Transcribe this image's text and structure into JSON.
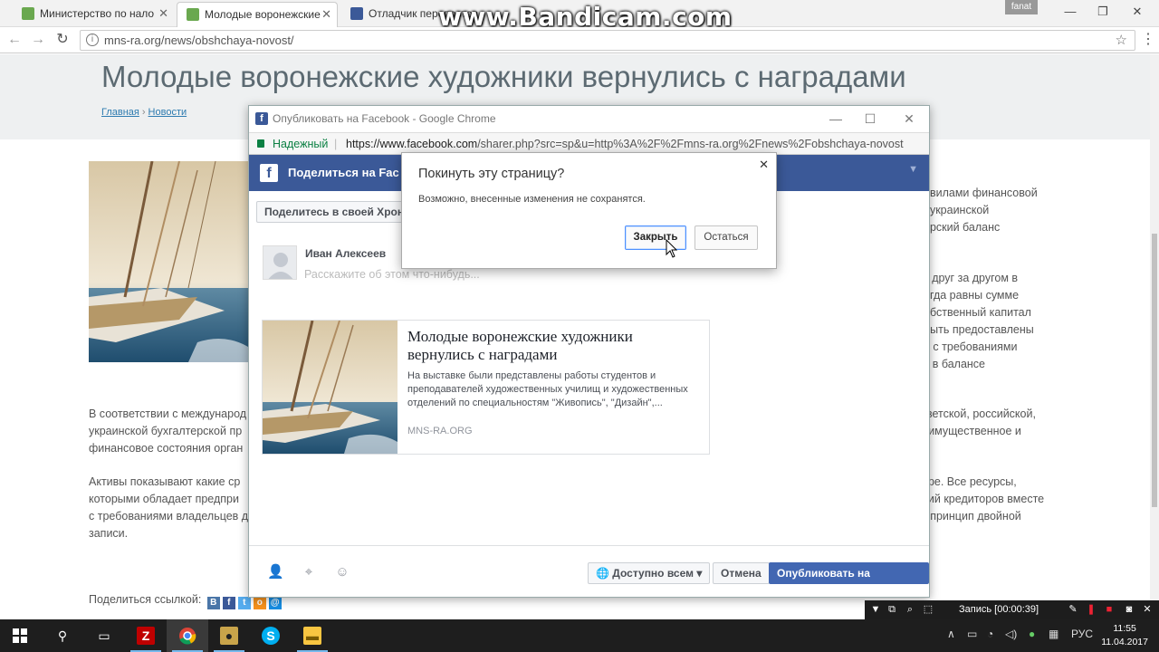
{
  "watermark": "www.Bandicam.com",
  "browser": {
    "tabs": [
      {
        "title": "Министерство по нало",
        "favicon_color": "#6aa84f"
      },
      {
        "title": "Молодые воронежские",
        "favicon_color": "#6aa84f"
      },
      {
        "title": "Отладчик перепостов",
        "favicon_color": "#3b5998"
      }
    ],
    "user_badge": "fanat",
    "url": "mns-ra.org/news/obshchaya-novost/",
    "window_controls": {
      "minimize": "—",
      "maximize": "❐",
      "close": "✕"
    }
  },
  "page": {
    "title": "Молодые воронежские художники вернулись с наградами",
    "breadcrumb": {
      "home": "Главная",
      "news": "Новости"
    },
    "right_col_1": [
      "авилами финансовой",
      ", украинской",
      "ерский баланс"
    ],
    "right_col_2": [
      "т друг за другом в",
      "егда равны сумме",
      "обственный капитал",
      "быть предоставлены",
      "е с требованиями",
      "х в балансе"
    ],
    "para1_left": [
      "В соответствии с международ",
      "украинской бухгалтерской пр",
      "финансовое состояния орган"
    ],
    "para1_right": [
      "оветской, российской,",
      "т имущественное и"
    ],
    "para2_left": [
      "Активы показывают какие ср",
      "которыми обладает предпри",
      "с требованиями владельцев д",
      "записи."
    ],
    "para2_right": [
      "ере. Все ресурсы,",
      "ний кредиторов вместе",
      "т принцип двойной"
    ],
    "share_label": "Поделиться ссылкой:"
  },
  "popup": {
    "window_title": "Опубликовать на Facebook - Google Chrome",
    "secure_label": "Надежный",
    "url_host": "https://www.facebook.com",
    "url_rest": "/sharer.php?src=sp&u=http%3A%2F%2Fmns-ra.org%2Fnews%2Fobshchaya-novost",
    "fb_header": "Поделиться на Fac",
    "share_where": "Поделитесь в своей Хрони",
    "user_name": "Иван Алексеев",
    "composer_placeholder": "Расскажите об этом что-нибудь...",
    "link": {
      "title": "Молодые воронежские художники вернулись с наградами",
      "description": "На выставке были представлены работы студентов и преподавателей художественных училищ и художественных отделений по специальностям \"Живопись\", \"Дизайн\",...",
      "domain": "MNS-RA.ORG"
    },
    "audience_label": "Доступно всем",
    "cancel_label": "Отмена",
    "publish_label": "Опубликовать на Facebook"
  },
  "dialog": {
    "title": "Покинуть эту страницу?",
    "message": "Возможно, внесенные изменения не сохранятся.",
    "close_label": "Закрыть",
    "stay_label": "Остаться"
  },
  "recorder": {
    "status": "Запись [00:00:39]"
  },
  "taskbar": {
    "lang": "РУС",
    "time": "11:55",
    "date": "11.04.2017"
  },
  "colors": {
    "facebook_blue": "#3b5998",
    "publish_button": "#4267b2",
    "link_blue": "#2e7bb0"
  }
}
